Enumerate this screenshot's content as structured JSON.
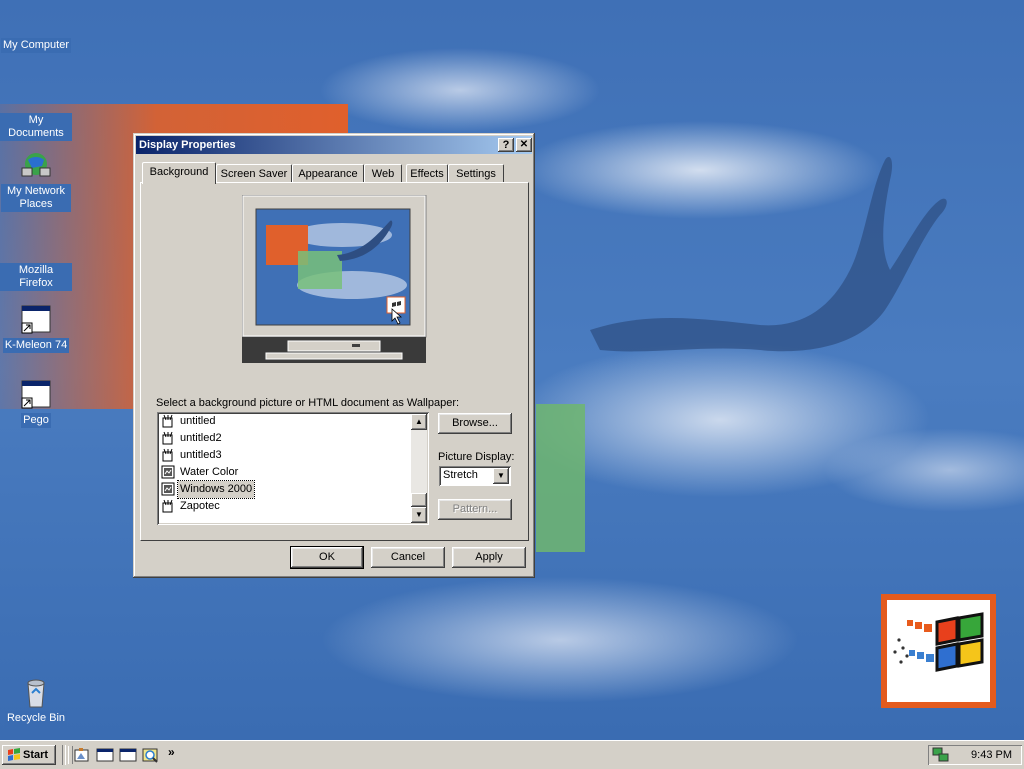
{
  "desktop": {
    "icons": [
      {
        "label": "My Computer"
      },
      {
        "label": "My Documents"
      },
      {
        "label": "My Network Places"
      },
      {
        "label": "Mozilla Firefox"
      },
      {
        "label": "K-Meleon 74"
      },
      {
        "label": "Pego"
      },
      {
        "label": "Recycle Bin"
      }
    ]
  },
  "dialog": {
    "title": "Display Properties",
    "help_glyph": "?",
    "close_glyph": "✕",
    "tabs": [
      {
        "label": "Background",
        "active": true
      },
      {
        "label": "Screen Saver"
      },
      {
        "label": "Appearance"
      },
      {
        "label": "Web"
      },
      {
        "label": "Effects"
      },
      {
        "label": "Settings"
      }
    ],
    "wallpaper_prompt": "Select a background picture or HTML document as Wallpaper:",
    "wallpaper_list": [
      {
        "name": "untitled",
        "icon": "paint-icon"
      },
      {
        "name": "untitled2",
        "icon": "paint-icon"
      },
      {
        "name": "untitled3",
        "icon": "paint-icon"
      },
      {
        "name": "Water Color",
        "icon": "image-icon"
      },
      {
        "name": "Windows 2000",
        "icon": "image-icon",
        "selected": true
      },
      {
        "name": "Zapotec",
        "icon": "paint-icon"
      }
    ],
    "browse_label": "Browse...",
    "picture_display_label": "Picture Display:",
    "picture_display_value": "Stretch",
    "pattern_label": "Pattern...",
    "ok_label": "OK",
    "cancel_label": "Cancel",
    "apply_label": "Apply"
  },
  "taskbar": {
    "start_label": "Start",
    "more_glyph": "»",
    "clock": "9:43 PM"
  },
  "colors": {
    "titlebar_start": "#0a246a",
    "titlebar_end": "#a6caf0",
    "face": "#d4d0c8",
    "desktop": "#3d6fb4",
    "accent_orange": "#e0602c"
  }
}
